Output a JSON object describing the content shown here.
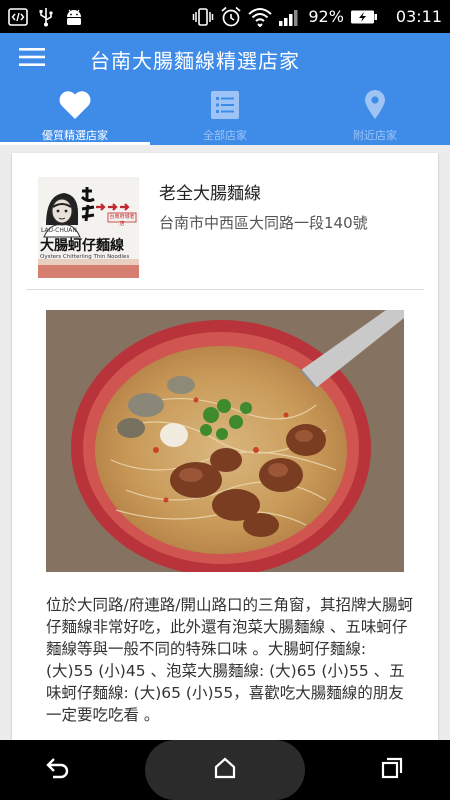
{
  "status_bar": {
    "battery_percent": "92%",
    "time": "03:11",
    "icons": [
      "code-icon",
      "usb-icon",
      "android-icon",
      "vibrate-icon",
      "alarm-icon",
      "wifi-icon",
      "signal-icon",
      "battery-icon"
    ]
  },
  "app_bar": {
    "title": "台南大腸麵線精選店家",
    "menu_icon": "hamburger-menu-icon"
  },
  "tabs": [
    {
      "label": "優質精選店家",
      "icon": "heart-icon",
      "active": true
    },
    {
      "label": "全部店家",
      "icon": "list-icon",
      "active": false
    },
    {
      "label": "附近店家",
      "icon": "location-pin-icon",
      "active": false
    }
  ],
  "shop": {
    "name": "老全大腸麵線",
    "address": "台南市中西區大同路一段140號",
    "logo": {
      "big_text": "老全",
      "romanized": "LAU-CHUAN",
      "tag": "台南府城老店",
      "product": "大腸蚵仔麵線",
      "english": "Oysters Chitterling Thin Noodles"
    },
    "description": "位於大同路/府連路/開山路口的三角窗，其招牌大腸蚵仔麵線非常好吃，此外還有泡菜大腸麵線 、五味蚵仔麵線等與一般不同的特殊口味 。大腸蚵仔麵線: (大)55 (小)45 、泡菜大腸麵線: (大)65 (小)55 、五味蚵仔麵線: (大)65 (小)55，喜歡吃大腸麵線的朋友一定要吃吃看 。"
  },
  "nav_bar": {
    "buttons": [
      "back-icon",
      "home-icon",
      "recents-icon"
    ]
  },
  "colors": {
    "primary": "#3f8be8",
    "tab_inactive": "#9dc4f4",
    "background": "#ececec"
  }
}
